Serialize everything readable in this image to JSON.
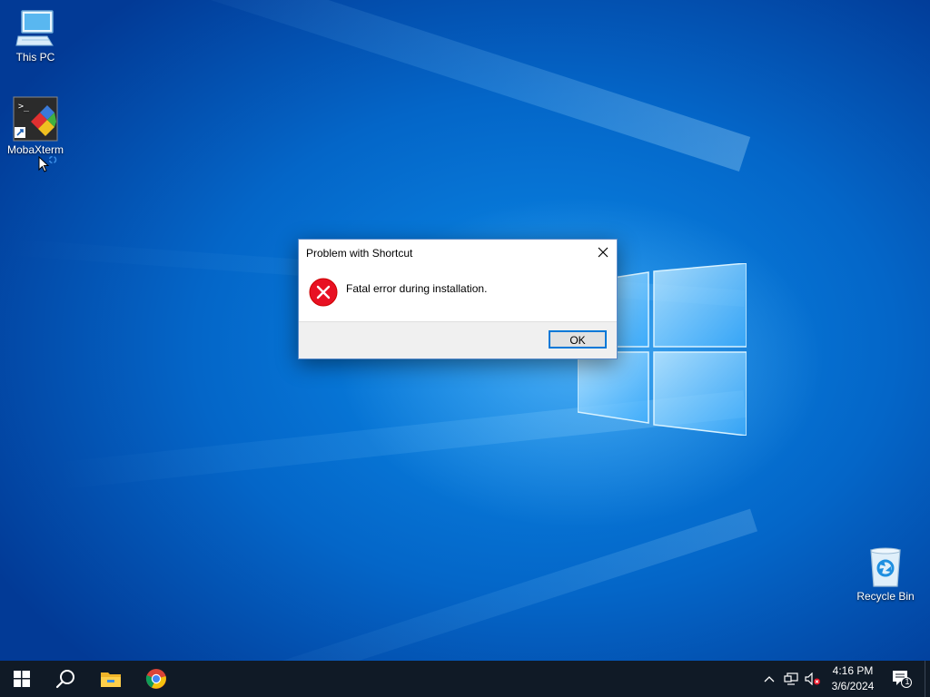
{
  "desktop": {
    "icons": [
      {
        "label": "This PC",
        "icon": "this-pc-icon"
      },
      {
        "label": "MobaXterm",
        "icon": "mobaxterm-icon"
      },
      {
        "label": "Recycle Bin",
        "icon": "recycle-bin-icon"
      }
    ]
  },
  "dialog": {
    "title": "Problem with Shortcut",
    "message": "Fatal error during installation.",
    "ok_label": "OK",
    "icon": "error-icon",
    "close_icon": "close-icon"
  },
  "taskbar": {
    "start_icon": "windows-start-icon",
    "search_icon": "search-icon",
    "pinned": [
      {
        "name": "file-explorer",
        "icon": "folder-icon"
      },
      {
        "name": "chrome",
        "icon": "chrome-icon"
      }
    ],
    "tray": {
      "chevron_icon": "chevron-up-icon",
      "network_icon": "network-icon",
      "volume_icon": "volume-muted-icon",
      "notification_icon": "action-center-icon",
      "notification_count": "1"
    },
    "clock": {
      "time": "4:16 PM",
      "date": "3/6/2024"
    }
  },
  "colors": {
    "accent": "#0078d7",
    "error_red": "#e81123",
    "taskbar": "#101a26"
  }
}
